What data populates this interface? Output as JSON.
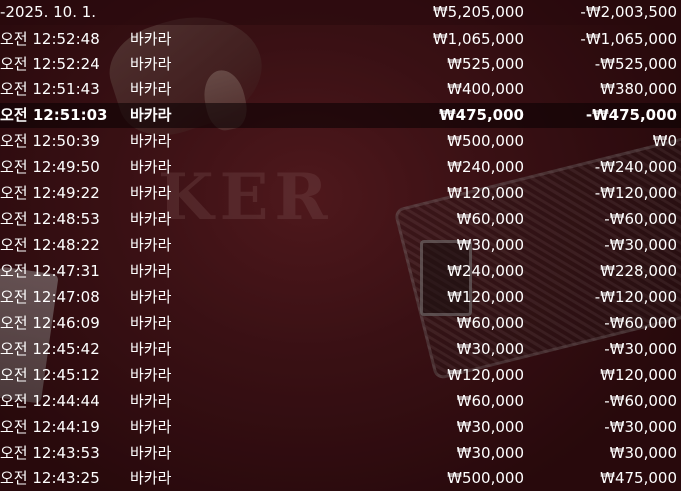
{
  "summary": {
    "date": "-2025. 10. 1.",
    "total_bet": "₩5,205,000",
    "total_result": "-₩2,003,500"
  },
  "rows": [
    {
      "time": "오전 12:52:48",
      "game": "바카라",
      "bet": "₩1,065,000",
      "result": "-₩1,065,000"
    },
    {
      "time": "오전 12:52:24",
      "game": "바카라",
      "bet": "₩525,000",
      "result": "-₩525,000"
    },
    {
      "time": "오전 12:51:43",
      "game": "바카라",
      "bet": "₩400,000",
      "result": "₩380,000"
    },
    {
      "time": "오전 12:51:03",
      "game": "바카라",
      "bet": "₩475,000",
      "result": "-₩475,000"
    },
    {
      "time": "오전 12:50:39",
      "game": "바카라",
      "bet": "₩500,000",
      "result": "₩0"
    },
    {
      "time": "오전 12:49:50",
      "game": "바카라",
      "bet": "₩240,000",
      "result": "-₩240,000"
    },
    {
      "time": "오전 12:49:22",
      "game": "바카라",
      "bet": "₩120,000",
      "result": "-₩120,000"
    },
    {
      "time": "오전 12:48:53",
      "game": "바카라",
      "bet": "₩60,000",
      "result": "-₩60,000"
    },
    {
      "time": "오전 12:48:22",
      "game": "바카라",
      "bet": "₩30,000",
      "result": "-₩30,000"
    },
    {
      "time": "오전 12:47:31",
      "game": "바카라",
      "bet": "₩240,000",
      "result": "₩228,000"
    },
    {
      "time": "오전 12:47:08",
      "game": "바카라",
      "bet": "₩120,000",
      "result": "-₩120,000"
    },
    {
      "time": "오전 12:46:09",
      "game": "바카라",
      "bet": "₩60,000",
      "result": "-₩60,000"
    },
    {
      "time": "오전 12:45:42",
      "game": "바카라",
      "bet": "₩30,000",
      "result": "-₩30,000"
    },
    {
      "time": "오전 12:45:12",
      "game": "바카라",
      "bet": "₩120,000",
      "result": "₩120,000"
    },
    {
      "time": "오전 12:44:44",
      "game": "바카라",
      "bet": "₩60,000",
      "result": "-₩60,000"
    },
    {
      "time": "오전 12:44:19",
      "game": "바카라",
      "bet": "₩30,000",
      "result": "-₩30,000"
    },
    {
      "time": "오전 12:43:53",
      "game": "바카라",
      "bet": "₩30,000",
      "result": "₩30,000"
    },
    {
      "time": "오전 12:43:25",
      "game": "바카라",
      "bet": "₩500,000",
      "result": "₩475,000"
    }
  ],
  "background": {
    "watermark": "KER"
  }
}
